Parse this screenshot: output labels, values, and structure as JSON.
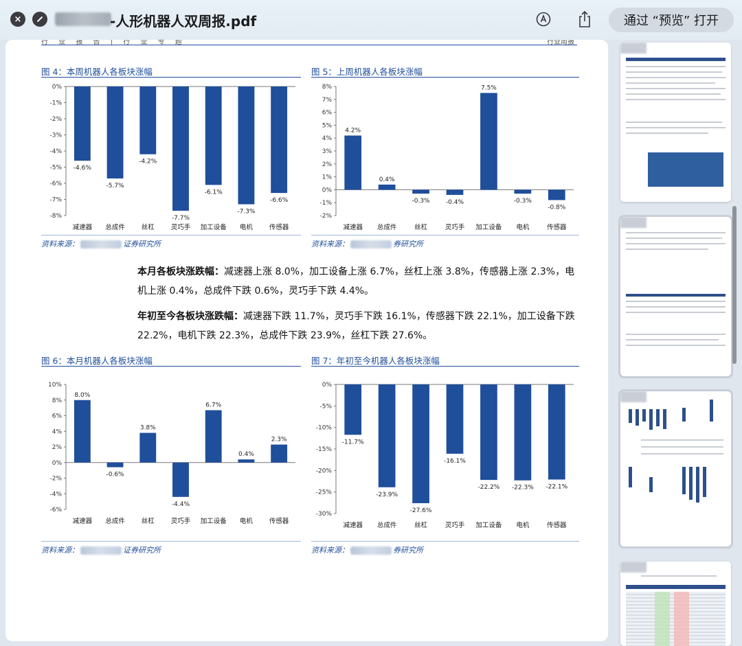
{
  "window": {
    "title": "-人形机器人双周报.pdf",
    "open_button": "通过 “预览” 打开",
    "icons": {
      "close": "close-icon",
      "minimize": "minimize-icon",
      "markup": "markup-icon",
      "share": "share-icon"
    }
  },
  "page": {
    "header_left": "行 业 报 告 | 行 业 专 题",
    "header_right": "行业周报",
    "colors": {
      "bar": "#1f4e9b",
      "accent": "#1f4e9b"
    },
    "para1": {
      "lead": "本月各板块涨跌幅：",
      "body": "减速器上涨 8.0%，加工设备上涨 6.7%，丝杠上涨 3.8%，传感器上涨 2.3%，电机上涨 0.4%，总成件下跌 0.6%，灵巧手下跌 4.4%。"
    },
    "para2": {
      "lead": "年初至今各板块涨跌幅：",
      "body": "减速器下跌 11.7%，灵巧手下跌 16.1%，传感器下跌 22.1%，加工设备下跌 22.2%，电机下跌 22.3%，总成件下跌 23.9%，丝杠下跌 27.6%。"
    },
    "source_prefix": "资料来源：",
    "source_suffix_a": "证券研究所",
    "source_suffix_b": "券研究所"
  },
  "chart_data": [
    {
      "title": "图 4：本周机器人各板块涨幅",
      "type": "bar",
      "categories": [
        "减速器",
        "总成件",
        "丝杠",
        "灵巧手",
        "加工设备",
        "电机",
        "传感器"
      ],
      "values": [
        -4.6,
        -5.7,
        -4.2,
        -7.7,
        -6.1,
        -7.3,
        -6.6
      ],
      "ylim": [
        -8,
        0
      ],
      "yticks": [
        "0%",
        "-1%",
        "-2%",
        "-3%",
        "-4%",
        "-5%",
        "-6%",
        "-7%",
        "-8%"
      ]
    },
    {
      "title": "图 5：上周机器人各板块涨幅",
      "type": "bar",
      "categories": [
        "减速器",
        "总成件",
        "丝杠",
        "灵巧手",
        "加工设备",
        "电机",
        "传感器"
      ],
      "values": [
        4.2,
        0.4,
        -0.3,
        -0.4,
        7.5,
        -0.3,
        -0.8
      ],
      "ylim": [
        -2,
        8
      ],
      "yticks": [
        "8%",
        "7%",
        "6%",
        "5%",
        "4%",
        "3%",
        "2%",
        "1%",
        "0%",
        "-1%",
        "-2%"
      ]
    },
    {
      "title": "图 6：本月机器人各板块涨幅",
      "type": "bar",
      "categories": [
        "减速器",
        "总成件",
        "丝杠",
        "灵巧手",
        "加工设备",
        "电机",
        "传感器"
      ],
      "values": [
        8.0,
        -0.6,
        3.8,
        -4.4,
        6.7,
        0.4,
        2.3
      ],
      "ylim": [
        -6,
        10
      ],
      "yticks": [
        "10%",
        "8%",
        "6%",
        "4%",
        "2%",
        "0%",
        "-2%",
        "-4%",
        "-6%"
      ]
    },
    {
      "title": "图 7：年初至今机器人各板块涨幅",
      "type": "bar",
      "categories": [
        "减速器",
        "总成件",
        "丝杠",
        "灵巧手",
        "加工设备",
        "电机",
        "传感器"
      ],
      "values": [
        -11.7,
        -23.9,
        -27.6,
        -16.1,
        -22.2,
        -22.3,
        -22.1
      ],
      "ylim": [
        -30,
        0
      ],
      "yticks": [
        "0%",
        "-5%",
        "-10%",
        "-15%",
        "-20%",
        "-25%",
        "-30%"
      ]
    }
  ]
}
